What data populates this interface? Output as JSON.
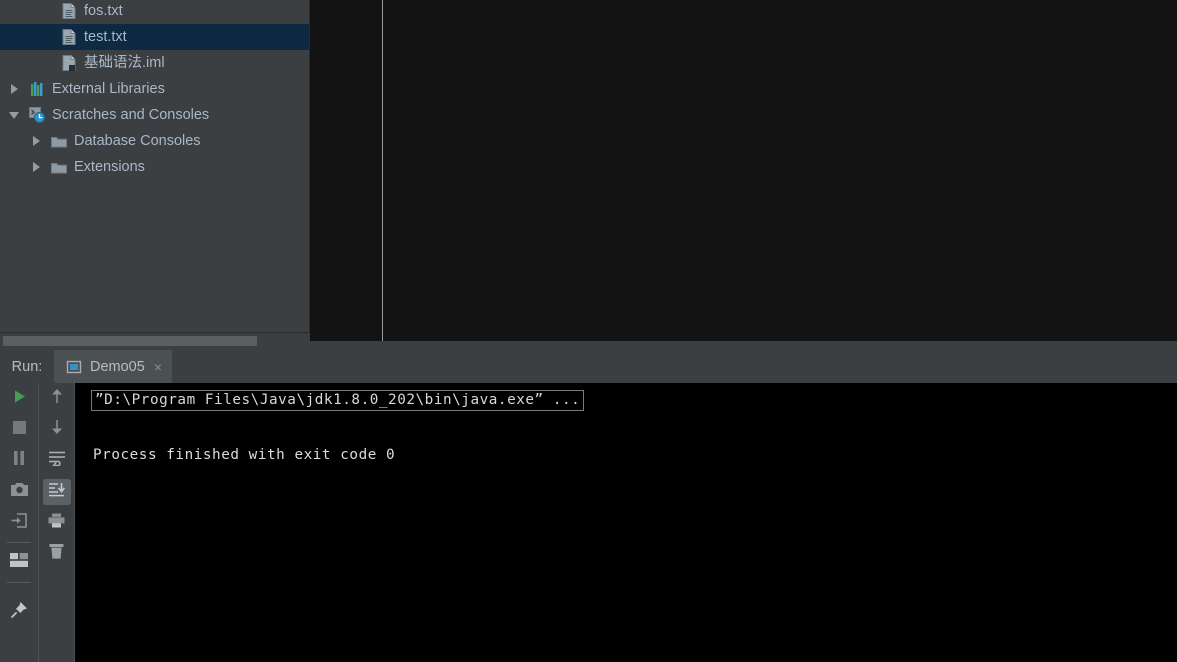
{
  "sidebar": {
    "items": [
      {
        "label": "fos.txt",
        "icon": "text-file-icon",
        "indent": 60,
        "twisty": "",
        "selected": false
      },
      {
        "label": "test.txt",
        "icon": "text-file-icon",
        "indent": 60,
        "twisty": "",
        "selected": true
      },
      {
        "label": "基础语法.iml",
        "icon": "iml-file-icon",
        "indent": 60,
        "twisty": "",
        "selected": false
      },
      {
        "label": "External Libraries",
        "icon": "libraries-icon",
        "indent": 12,
        "twisty": "collapsed",
        "selected": false
      },
      {
        "label": "Scratches and Consoles",
        "icon": "scratches-icon",
        "indent": 12,
        "twisty": "expanded",
        "selected": false
      },
      {
        "label": "Database Consoles",
        "icon": "folder-icon",
        "indent": 34,
        "twisty": "collapsed",
        "selected": false
      },
      {
        "label": "Extensions",
        "icon": "folder-icon",
        "indent": 34,
        "twisty": "collapsed",
        "selected": false
      }
    ]
  },
  "run_window": {
    "title": "Run:",
    "tab": {
      "label": "Demo05",
      "icon": "run-configuration-icon",
      "close_label": "×"
    },
    "toolbar_left": [
      {
        "name": "rerun-button",
        "icon": "play-icon"
      },
      {
        "name": "stop-button",
        "icon": "stop-icon"
      },
      {
        "name": "pause-button",
        "icon": "pause-icon"
      },
      {
        "name": "screenshot-button",
        "icon": "camera-icon"
      },
      {
        "name": "export-button",
        "icon": "export-icon"
      },
      {
        "name": "layout-button",
        "icon": "layout-icon"
      },
      {
        "name": "pin-tab-button",
        "icon": "pin-icon"
      }
    ],
    "toolbar_right": [
      {
        "name": "up-the-stack-trace-button",
        "icon": "arrow-up-icon"
      },
      {
        "name": "down-the-stack-trace-button",
        "icon": "arrow-down-icon"
      },
      {
        "name": "soft-wrap-button",
        "icon": "soft-wrap-icon"
      },
      {
        "name": "scroll-to-end-button",
        "icon": "scroll-to-end-icon",
        "selected": true
      },
      {
        "name": "print-button",
        "icon": "print-icon"
      },
      {
        "name": "clear-all-button",
        "icon": "trash-icon"
      }
    ],
    "console": {
      "command_line": "”D:\\Program Files\\Java\\jdk1.8.0_202\\bin\\java.exe” ...",
      "exit_line": "Process finished with exit code 0"
    }
  },
  "colors": {
    "panel_bg": "#3c3f41",
    "editor_bg": "#131313",
    "console_bg": "#000000",
    "selection_bg": "#0d2a42",
    "text_primary": "#a9b7c6",
    "text_secondary": "#bbbbbb",
    "accent_green": "#499c54",
    "accent_blue": "#3592c4"
  }
}
